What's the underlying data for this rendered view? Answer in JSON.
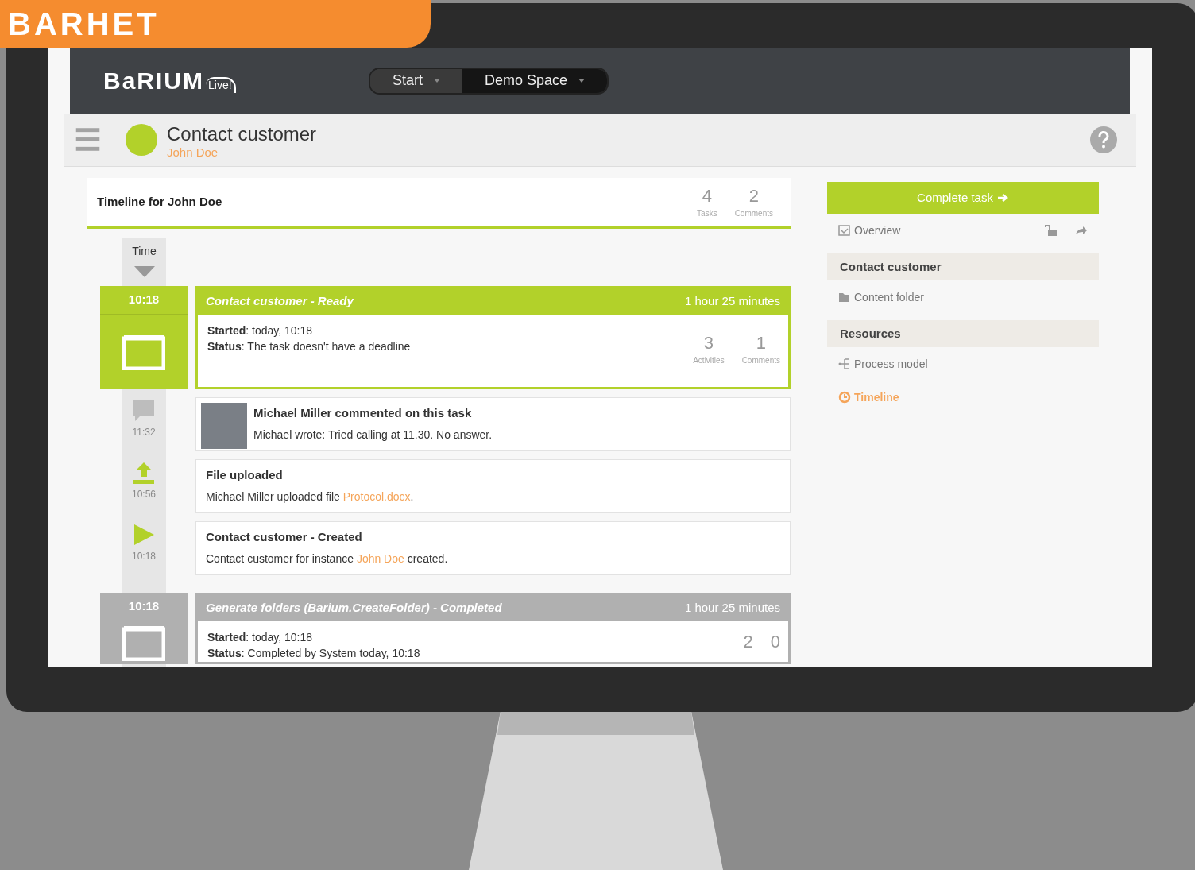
{
  "banner": {
    "text": "BARHET"
  },
  "header": {
    "logo": "BaRIUM",
    "logo_badge": "Live!",
    "nav": [
      {
        "label": "Start",
        "selected": false
      },
      {
        "label": "Demo Space",
        "selected": true
      }
    ]
  },
  "title_bar": {
    "title": "Contact customer",
    "subtitle": "John Doe"
  },
  "timeline": {
    "title": "Timeline for John Doe",
    "counts": [
      {
        "value": "4",
        "label": "Tasks"
      },
      {
        "value": "2",
        "label": "Comments"
      }
    ],
    "time_label": "Time",
    "items": [
      {
        "kind": "task",
        "active": true,
        "time": "10:18",
        "title": "Contact customer - Ready",
        "duration": "1 hour 25 minutes",
        "fields": [
          {
            "label": "Started",
            "value": ": today, 10:18"
          },
          {
            "label": "Status",
            "value": ": The task doesn't have a deadline"
          }
        ],
        "counts": [
          {
            "value": "3",
            "label": "Activities"
          },
          {
            "value": "1",
            "label": "Comments"
          }
        ]
      },
      {
        "kind": "comment",
        "time": "11:32",
        "title": "Michael Miller commented on this task",
        "text": "Michael wrote: Tried calling at 11.30. No answer."
      },
      {
        "kind": "upload",
        "time": "10:56",
        "title": "File uploaded",
        "text": "Michael Miller uploaded file ",
        "link": "Protocol.docx",
        "text_after": "."
      },
      {
        "kind": "created",
        "time": "10:18",
        "title": "Contact customer - Created",
        "text": "Contact customer for instance ",
        "link": "John Doe",
        "text_after": " created."
      },
      {
        "kind": "task",
        "active": false,
        "time": "10:18",
        "title": "Generate folders (Barium.CreateFolder) - Completed",
        "duration": "1 hour 25 minutes",
        "fields": [
          {
            "label": "Started",
            "value": ": today, 10:18"
          },
          {
            "label": "Status",
            "value": ": Completed by System today, 10:18"
          }
        ],
        "counts": [
          {
            "value": "2"
          },
          {
            "value": "0"
          }
        ]
      }
    ]
  },
  "sidebar": {
    "button": "Complete task",
    "items": [
      {
        "kind": "overview",
        "label": "Overview",
        "selected": false
      },
      {
        "kind": "section",
        "label": "Contact customer"
      },
      {
        "kind": "folder",
        "label": "Content folder",
        "selected": false
      },
      {
        "kind": "section",
        "label": "Resources"
      },
      {
        "kind": "model",
        "label": "Process model",
        "selected": false
      },
      {
        "kind": "timeline",
        "label": "Timeline",
        "selected": true
      }
    ]
  }
}
